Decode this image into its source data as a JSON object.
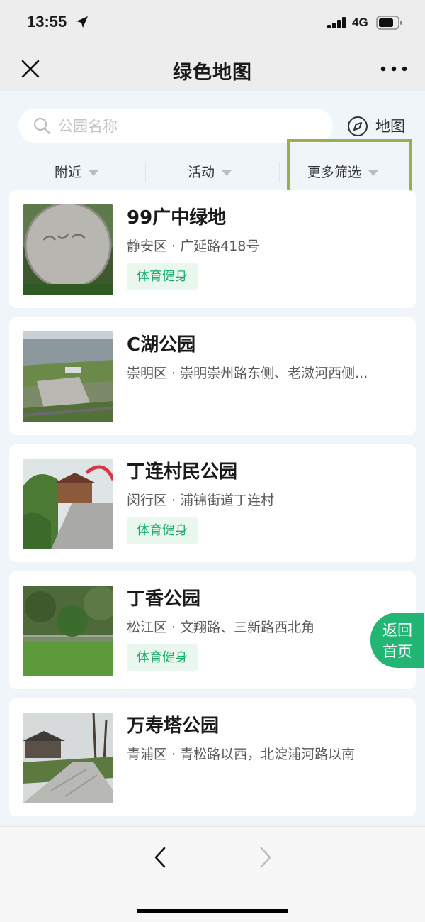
{
  "status_bar": {
    "time": "13:55",
    "network": "4G",
    "icons": [
      "location-arrow-icon",
      "signal-icon",
      "battery-icon"
    ]
  },
  "nav": {
    "title": "绿色地图",
    "icons": [
      "close-icon",
      "more-icon"
    ]
  },
  "search": {
    "placeholder": "公园名称",
    "icon": "search-icon"
  },
  "map_button": {
    "label": "地图",
    "icon": "compass-icon"
  },
  "filters": [
    {
      "label": "附近"
    },
    {
      "label": "活动"
    },
    {
      "label": "更多筛选"
    }
  ],
  "parks": [
    {
      "name": "99广中绿地",
      "address": "静安区 · 广延路418号",
      "tag": "体育健身"
    },
    {
      "name": "C湖公园",
      "address": "崇明区 · 崇明崇州路东侧、老滧河西侧..."
    },
    {
      "name": "丁连村民公园",
      "address": "闵行区 · 浦锦街道丁连村",
      "tag": "体育健身"
    },
    {
      "name": "丁香公园",
      "address": "松江区 · 文翔路、三新路西北角",
      "tag": "体育健身"
    },
    {
      "name": "万寿塔公园",
      "address": "青浦区 · 青松路以西，北淀浦河路以南"
    }
  ],
  "return_home": {
    "line1": "返回",
    "line2": "首页"
  },
  "bottom_nav": {
    "icons": [
      "back-chevron-icon",
      "forward-chevron-icon"
    ]
  },
  "colors": {
    "accent_green": "#22b573",
    "tag_text": "#1aad6a",
    "tag_bg": "#e9f7ef",
    "highlight_border": "#9aad4f"
  }
}
